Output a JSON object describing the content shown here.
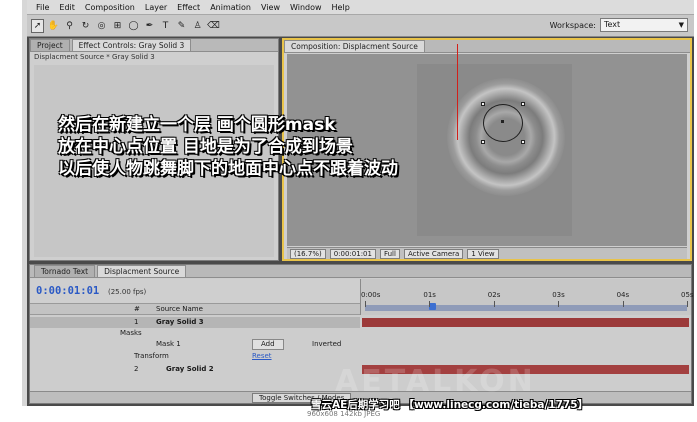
{
  "menubar": {
    "items": [
      "File",
      "Edit",
      "Composition",
      "Layer",
      "Effect",
      "Animation",
      "View",
      "Window",
      "Help"
    ]
  },
  "toolbar": {
    "tools": [
      "selection-tool-icon",
      "hand-tool-icon",
      "zoom-tool-icon",
      "rotate-tool-icon",
      "camera-tool-icon",
      "pan-behind-tool-icon",
      "ellipse-mask-tool-icon",
      "pen-tool-icon",
      "type-tool-icon",
      "brush-tool-icon",
      "clone-stamp-tool-icon",
      "eraser-tool-icon"
    ],
    "workspace_label": "Workspace:",
    "workspace_value": "Text"
  },
  "left_panel": {
    "tabs": [
      "Project",
      "Effect Controls: Gray Solid 3"
    ],
    "subtitle": "Displacment Source * Gray Solid 3"
  },
  "comp_panel": {
    "tab": "Composition: Displacment Source",
    "zoom": "(16.7%)",
    "timecode": "0:00:01:01",
    "resolution": "Full",
    "camera": "Active Camera",
    "views": "1 View"
  },
  "timeline": {
    "tabs": [
      "Tornado Text",
      "Displacment Source"
    ],
    "current_time": "0:00:01:01",
    "fps": "(25.00 fps)",
    "columns": {
      "num": "#",
      "source_name": "Source Name"
    },
    "ruler_ticks": [
      "0:00s",
      "01s",
      "02s",
      "03s",
      "04s",
      "05s"
    ],
    "playhead_seconds": 1.04,
    "duration_seconds": 5,
    "layers": [
      {
        "index": "1",
        "name": "Gray Solid 3"
      },
      {
        "index": "2",
        "name": "Gray Solid 2"
      }
    ],
    "masks_label": "Masks",
    "mask_name": "Mask 1",
    "mask_mode": "Add",
    "mask_inverted": "Inverted",
    "transform_label": "Transform",
    "reset_label": "Reset",
    "toggle_label": "Toggle Switches / Modes"
  },
  "caption": {
    "line1": "然后在新建立一个层 画个圆形mask",
    "line2": "放在中心点位置 目地是为了合成到场景",
    "line3": "以后使人物跳舞脚下的地面中心点不跟着波动"
  },
  "watermark": {
    "text": "雪云AE后期学习吧 【www.linecg.com/tieba/1775】",
    "image_meta": "960x608 142kb JPEG",
    "logo": "AETALKON"
  },
  "colors": {
    "accent_border": "#e8c34a",
    "timecode": "#2a59c5",
    "playhead": "#d2201a",
    "layer_bar": "#9c3a3a"
  }
}
